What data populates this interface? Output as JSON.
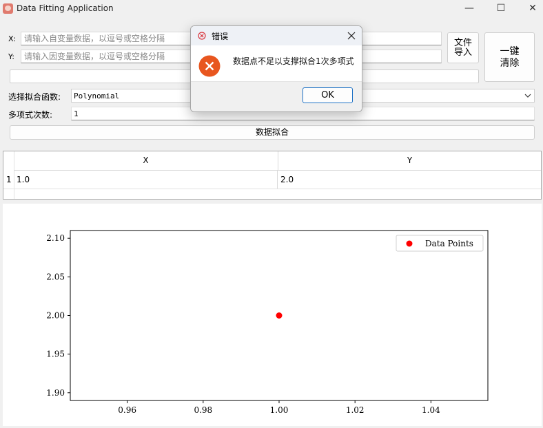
{
  "window": {
    "title": "Data Fitting Application",
    "minimize_glyph": "—",
    "maximize_glyph": "☐",
    "close_glyph": "✕"
  },
  "inputs": {
    "x_label": "X:",
    "x_placeholder": "请输入自变量数据，以逗号或空格分隔",
    "x_value": "",
    "y_label": "Y:",
    "y_placeholder": "请输入因变量数据，以逗号或空格分隔",
    "y_value": "",
    "status_value": ""
  },
  "buttons": {
    "import_line1": "文件",
    "import_line2": "导入",
    "clear_line1": "一键",
    "clear_line2": "清除",
    "fit": "数据拟合"
  },
  "settings": {
    "function_label": "选择拟合函数:",
    "function_value": "Polynomial",
    "degree_label": "多项式次数:",
    "degree_value": "1"
  },
  "table": {
    "headers": [
      "X",
      "Y"
    ],
    "rows": [
      {
        "index": "1",
        "x": "1.0",
        "y": "2.0"
      }
    ]
  },
  "chart_data": {
    "type": "scatter",
    "series": [
      {
        "name": "Data Points",
        "x": [
          1.0
        ],
        "y": [
          2.0
        ],
        "color": "#ff0000"
      }
    ],
    "xlim": [
      0.945,
      1.055
    ],
    "ylim": [
      1.89,
      2.11
    ],
    "xticks": [
      "0.96",
      "0.98",
      "1.00",
      "1.02",
      "1.04"
    ],
    "yticks": [
      "2.10",
      "2.05",
      "2.00",
      "1.95",
      "1.90"
    ],
    "legend_position": "top-right",
    "grid": false
  },
  "dialog": {
    "title": "错误",
    "message": "数据点不足以支撑拟合1次多项式",
    "ok_label": "OK",
    "accent": "#e8561f"
  }
}
